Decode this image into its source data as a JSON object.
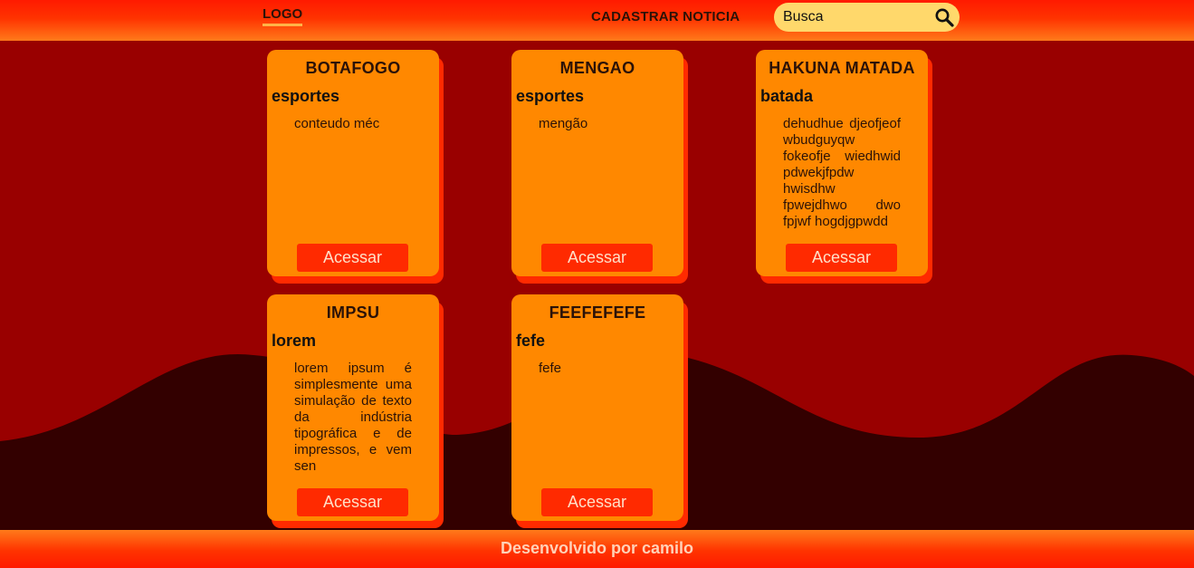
{
  "header": {
    "logo": "LOGO",
    "nav_link": "CADASTRAR NOTICIA",
    "search": {
      "placeholder": "Busca",
      "value": ""
    }
  },
  "cards": [
    {
      "title": "BOTAFOGO",
      "category": "esportes",
      "body": "conteudo méc",
      "button": "Acessar"
    },
    {
      "title": "MENGAO",
      "category": "esportes",
      "body": "mengão",
      "button": "Acessar"
    },
    {
      "title": "HAKUNA MATADA",
      "category": "batada",
      "body": "dehudhue djeofjeof wbudguyqw fokeofje wiedhwid pdwekjfpdw hwisdhw fpwejdhwo dwo fpjwf hogdjgpwdd",
      "button": "Acessar"
    },
    {
      "title": "IMPSU",
      "category": "lorem",
      "body": "lorem ipsum é simplesmente uma simulação de texto da indústria tipográfica e de impressos, e vem sen",
      "button": "Acessar"
    },
    {
      "title": "FEEFEFEFE",
      "category": "fefe",
      "body": "fefe",
      "button": "Acessar"
    }
  ],
  "footer": {
    "text": "Desenvolvido por camilo"
  },
  "colors": {
    "background": "#990000",
    "wave": "#330000",
    "card": "#ff8800",
    "card_shadow": "#ff2a00",
    "button": "#ff2a00",
    "search_bg": "#ffd86b"
  }
}
